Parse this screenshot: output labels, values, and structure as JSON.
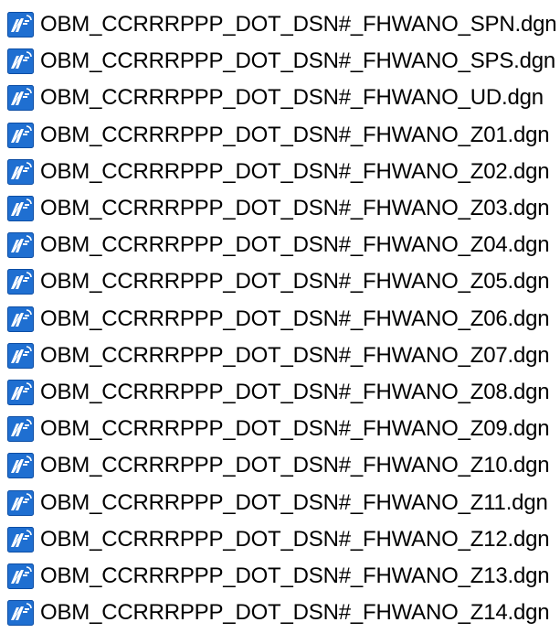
{
  "icon": "microstation-dgn-file-icon",
  "colors": {
    "icon_blue": "#1f6fd1",
    "icon_dark_blue": "#0d4ea5",
    "icon_light": "#ffffff",
    "text": "#000000"
  },
  "files": [
    {
      "name": "OBM_CCRRRPPP_DOT_DSN#_FHWANO_SPN.dgn"
    },
    {
      "name": "OBM_CCRRRPPP_DOT_DSN#_FHWANO_SPS.dgn"
    },
    {
      "name": "OBM_CCRRRPPP_DOT_DSN#_FHWANO_UD.dgn"
    },
    {
      "name": "OBM_CCRRRPPP_DOT_DSN#_FHWANO_Z01.dgn"
    },
    {
      "name": "OBM_CCRRRPPP_DOT_DSN#_FHWANO_Z02.dgn"
    },
    {
      "name": "OBM_CCRRRPPP_DOT_DSN#_FHWANO_Z03.dgn"
    },
    {
      "name": "OBM_CCRRRPPP_DOT_DSN#_FHWANO_Z04.dgn"
    },
    {
      "name": "OBM_CCRRRPPP_DOT_DSN#_FHWANO_Z05.dgn"
    },
    {
      "name": "OBM_CCRRRPPP_DOT_DSN#_FHWANO_Z06.dgn"
    },
    {
      "name": "OBM_CCRRRPPP_DOT_DSN#_FHWANO_Z07.dgn"
    },
    {
      "name": "OBM_CCRRRPPP_DOT_DSN#_FHWANO_Z08.dgn"
    },
    {
      "name": "OBM_CCRRRPPP_DOT_DSN#_FHWANO_Z09.dgn"
    },
    {
      "name": "OBM_CCRRRPPP_DOT_DSN#_FHWANO_Z10.dgn"
    },
    {
      "name": "OBM_CCRRRPPP_DOT_DSN#_FHWANO_Z11.dgn"
    },
    {
      "name": "OBM_CCRRRPPP_DOT_DSN#_FHWANO_Z12.dgn"
    },
    {
      "name": "OBM_CCRRRPPP_DOT_DSN#_FHWANO_Z13.dgn"
    },
    {
      "name": "OBM_CCRRRPPP_DOT_DSN#_FHWANO_Z14.dgn"
    }
  ]
}
